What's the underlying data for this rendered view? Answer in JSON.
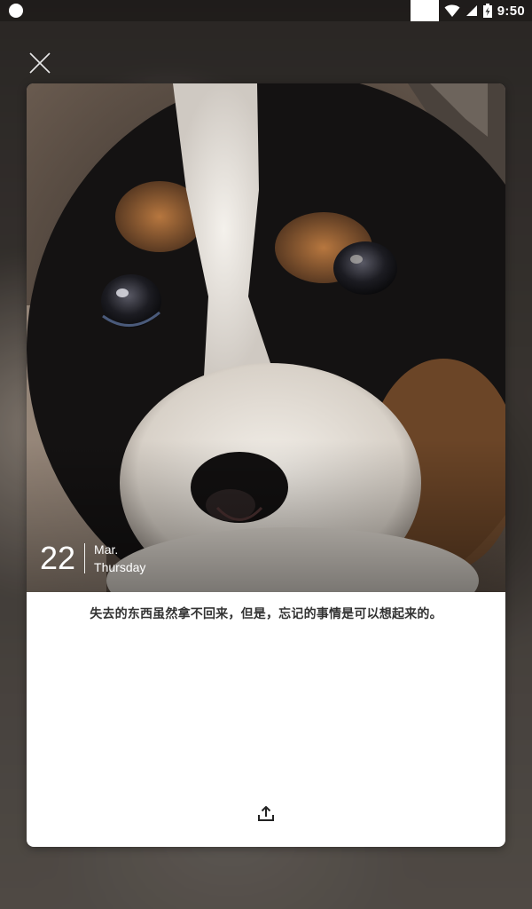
{
  "status_bar": {
    "time": "9:50",
    "icons": [
      "notification-dot-icon",
      "wifi-icon",
      "signal-icon",
      "battery-charging-icon"
    ]
  },
  "dialog": {
    "close_icon": "close-icon",
    "card": {
      "date": {
        "day": "22",
        "month": "Mar.",
        "weekday": "Thursday"
      },
      "quote": "失去的东西虽然拿不回来，但是，忘记的事情是可以想起来的。",
      "share_icon": "share-upload-icon"
    }
  }
}
